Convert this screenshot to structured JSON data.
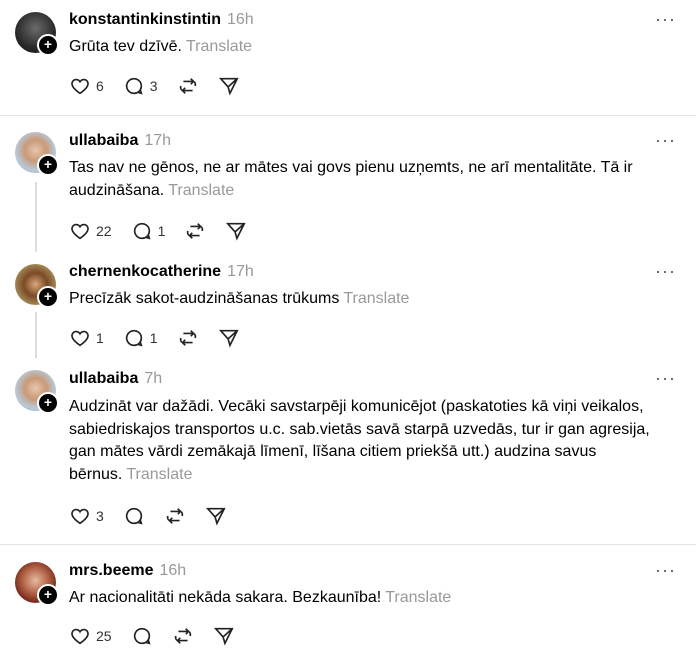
{
  "translate_label": "Translate",
  "posts": [
    {
      "username": "konstantinkinstintin",
      "time": "16h",
      "text": "Grūta tev dzīvē.",
      "likes": "6",
      "replies": "3",
      "avatar": "dark"
    },
    {
      "username": "ullabaiba",
      "time": "17h",
      "text": "Tas nav ne gēnos, ne ar mātes vai govs pienu uzņemts, ne arī mentalitāte. Tā ir audzināšana.",
      "likes": "22",
      "replies": "1",
      "avatar": "blonde"
    },
    {
      "username": "chernenkocatherine",
      "time": "17h",
      "text": "Precīzāk sakot-audzināšanas trūkums",
      "likes": "1",
      "replies": "1",
      "avatar": "brunette"
    },
    {
      "username": "ullabaiba",
      "time": "7h",
      "text": "Audzināt var dažādi. Vecāki savstarpēji komunicējot (paskatoties kā viņi veikalos, sabiedriskajos transportos u.c. sab.vietās savā starpā uzvedās, tur ir gan agresija, gan mātes vārdi zemākajā līmenī, līšana citiem priekšā utt.) audzina savus bērnus.",
      "likes": "3",
      "replies": "",
      "avatar": "blonde"
    },
    {
      "username": "mrs.beeme",
      "time": "16h",
      "text": "Ar nacionalitāti nekāda sakara. Bezkaunība!",
      "likes": "25",
      "replies": "",
      "avatar": "redhead"
    }
  ]
}
